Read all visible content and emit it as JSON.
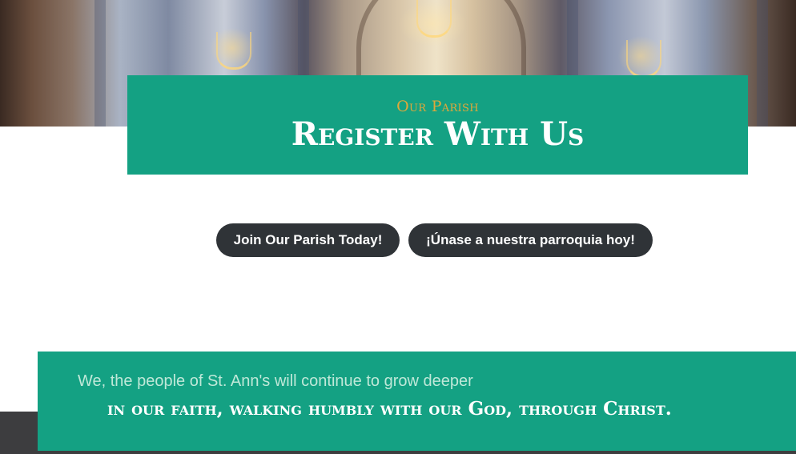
{
  "hero": {
    "image_alt": "church interior",
    "kicker": "Our Parish",
    "title": "Register With Us"
  },
  "buttons": {
    "join_english": "Join Our Parish Today!",
    "join_spanish": "¡Únase a nuestra parroquia hoy!"
  },
  "mission": {
    "line1": "We, the people of St. Ann's will continue to grow deeper",
    "line2": "in our faith, walking humbly with our God, through Christ."
  },
  "colors": {
    "accent_green": "#14a183",
    "gold": "#e0a83a",
    "button_dark": "#2f3337"
  }
}
